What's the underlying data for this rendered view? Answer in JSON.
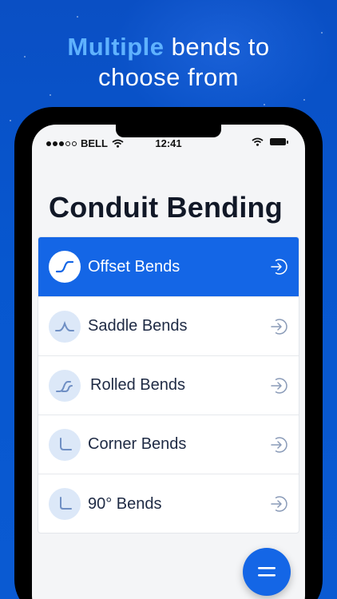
{
  "promo": {
    "headline_accent": "Multiple",
    "headline_rest": " bends to",
    "headline_line2": "choose from"
  },
  "status_bar": {
    "carrier": "BELL",
    "time": "12:41",
    "signal_bars_filled": 3,
    "signal_bars_total": 5
  },
  "page": {
    "title": "Conduit Bending"
  },
  "bends": [
    {
      "label": "Offset Bends",
      "icon": "offset-bend-icon",
      "active": true
    },
    {
      "label": "Saddle Bends",
      "icon": "saddle-bend-icon",
      "active": false
    },
    {
      "label": "Rolled Bends",
      "icon": "rolled-bend-icon",
      "active": false
    },
    {
      "label": "Corner Bends",
      "icon": "corner-bend-icon",
      "active": false
    },
    {
      "label": "90° Bends",
      "icon": "ninety-bend-icon",
      "active": false
    }
  ],
  "colors": {
    "background": "#0757cf",
    "accent_text": "#5fb2ff",
    "active_row": "#1466e6",
    "icon_circle": "#dce8f8",
    "icon_stroke": "#6f8fc4"
  },
  "fab": {
    "icon": "menu-icon"
  }
}
